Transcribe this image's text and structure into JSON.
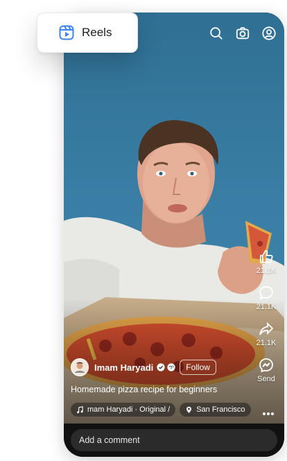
{
  "badge": {
    "label": "Reels"
  },
  "author": {
    "name": "Imam Haryadi",
    "follow_label": "Follow"
  },
  "caption": "Homemade pizza recipe for beginners",
  "chips": {
    "audio": "mam Haryadi · Original /",
    "location": "San Francisco"
  },
  "actions": {
    "like_count": "21.1K",
    "comment_count": "21.1K",
    "share_count": "21.1K",
    "send_label": "Send"
  },
  "comment_box": {
    "placeholder": "Add a comment"
  },
  "colors": {
    "accent": "#3b82f6",
    "bottom_bar": "#111111"
  },
  "icons": [
    "search-icon",
    "camera-icon",
    "profile-icon",
    "like-icon",
    "comment-icon",
    "share-icon",
    "messenger-icon",
    "more-icon",
    "music-icon",
    "location-icon",
    "reels-icon"
  ]
}
